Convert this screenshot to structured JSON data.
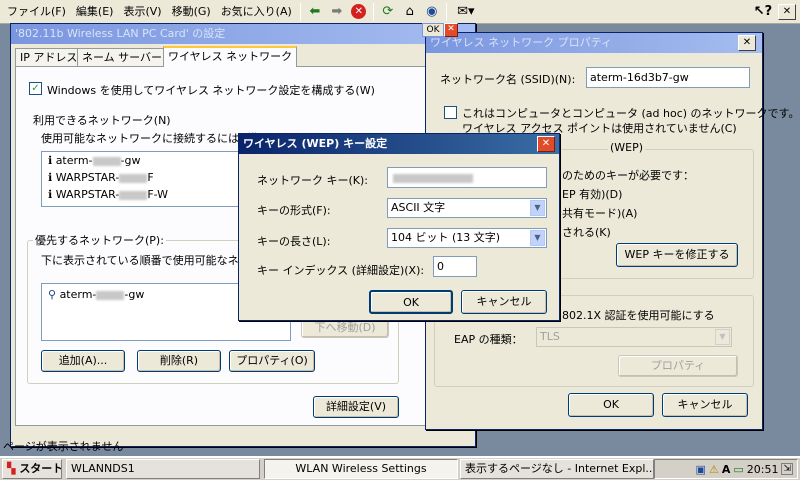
{
  "menubar": {
    "items": [
      "ファイル(F)",
      "編集(E)",
      "表示(V)",
      "移動(G)",
      "お気に入り(A)"
    ]
  },
  "toolbar_icons": [
    "back-icon",
    "forward-icon",
    "stop-icon",
    "refresh-icon",
    "home-icon",
    "search-icon",
    "favorites-icon",
    "help-icon"
  ],
  "card_window": {
    "title": "'802.11b Wireless LAN PC Card' の設定",
    "tabs": [
      "IP アドレス",
      "ネーム サーバー",
      "ワイヤレス ネットワーク"
    ],
    "use_windows_label": "Windows を使用してワイヤレス ネットワーク設定を構成する(W)",
    "available_label": "利用できるネットワーク(N)",
    "available_hint": "使用可能なネットワークに接続するには [構",
    "available_networks": [
      {
        "prefix": "aterm-",
        "suffix": "-gw"
      },
      {
        "prefix": "WARPSTAR-",
        "suffix": "F"
      },
      {
        "prefix": "WARPSTAR-",
        "suffix": "F-W"
      }
    ],
    "preferred_label": "優先するネットワーク(P):",
    "preferred_hint": "下に表示されている順番で使用可能なネ",
    "preferred_networks": [
      {
        "prefix": "aterm-",
        "suffix": "-gw"
      }
    ],
    "move_down_label": "下へ移動(D)",
    "add_label": "追加(A)...",
    "remove_label": "削除(R)",
    "properties_label": "プロパティ(O)",
    "advanced_label": "詳細設定(V)",
    "status_text": "ページが表示されません"
  },
  "props_window": {
    "title": "ワイヤレス ネットワーク プロパティ",
    "ok_label": "OK",
    "ssid_label": "ネットワーク名 (SSID)(N):",
    "ssid_value": "aterm-16d3b7-gw",
    "adhoc_label": "これはコンピュータとコンピュータ (ad hoc) のネットワークです。",
    "adhoc_label2": "ワイヤレス アクセス ポイントは使用されていません(C)",
    "wep_group_label": "(WEP)",
    "key_needed_label": "のためのキーが必要です：",
    "wep_enabled_label": "EP 有効)(D)",
    "shared_mode_label": "共有モード)(A)",
    "provided_label": "される(K)",
    "edit_wep_label": "WEP キーを修正する",
    "enable_8021x_label": "802.1X 認証を使用可能にする",
    "eap_type_label": "EAP の種類：",
    "eap_value": "TLS",
    "eap_properties_label": "プロパティ",
    "ok2_label": "OK",
    "cancel_label": "キャンセル"
  },
  "wep_dialog": {
    "title": "ワイヤレス (WEP) キー設定",
    "network_key_label": "ネットワーク キー(K):",
    "network_key_value": "",
    "key_format_label": "キーの形式(F):",
    "key_format_value": "ASCII 文字",
    "key_length_label": "キーの長さ(L):",
    "key_length_value": "104 ビット (13 文字)",
    "key_index_label": "キー インデックス (詳細設定)(X):",
    "key_index_value": "0",
    "ok_label": "OK",
    "cancel_label": "キャンセル"
  },
  "taskbar": {
    "start_label": "スタート",
    "tasks": [
      "WLANNDS1",
      "WLAN Wireless Settings",
      "表示するページなし - Internet Expl..."
    ],
    "clock": "20:51"
  }
}
